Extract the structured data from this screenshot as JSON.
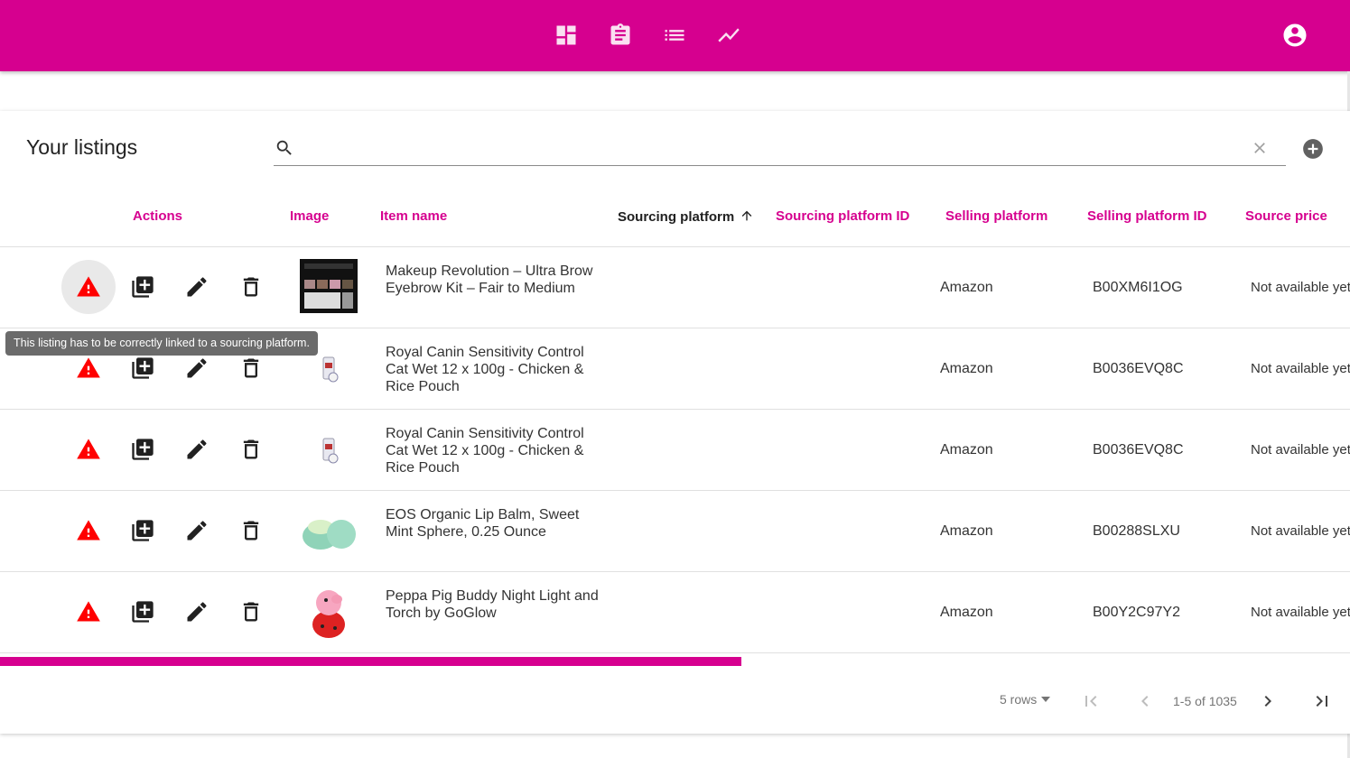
{
  "header": {
    "nav": [
      {
        "name": "dashboard-icon"
      },
      {
        "name": "assignment-icon"
      },
      {
        "name": "list-icon"
      },
      {
        "name": "trending-icon"
      }
    ],
    "account_icon": "account-circle-icon",
    "bg_color": "#d6008f"
  },
  "listings": {
    "title": "Your listings",
    "search": {
      "value": "",
      "placeholder": ""
    },
    "columns": {
      "actions": "Actions",
      "image": "Image",
      "item_name": "Item name",
      "sourcing_platform": "Sourcing platform",
      "sourcing_platform_id": "Sourcing platform ID",
      "selling_platform": "Selling platform",
      "selling_platform_id": "Selling platform ID",
      "source_price": "Source price"
    },
    "sort": {
      "column": "sourcing_platform",
      "direction": "asc"
    },
    "rows": [
      {
        "name": "Makeup Revolution – Ultra Brow Eyebrow Kit – Fair to Medium",
        "sourcing_platform": "",
        "sourcing_platform_id": "",
        "selling_platform": "Amazon",
        "selling_platform_id": "B00XM6I1OG",
        "source_price": "Not available yet",
        "image": "eyebrow-kit-image"
      },
      {
        "name": "Royal Canin Sensitivity Control Cat Wet 12 x 100g - Chicken & Rice Pouch",
        "sourcing_platform": "",
        "sourcing_platform_id": "",
        "selling_platform": "Amazon",
        "selling_platform_id": "B0036EVQ8C",
        "source_price": "Not available yet",
        "image": "cat-food-pouch-image"
      },
      {
        "name": "Royal Canin Sensitivity Control Cat Wet 12 x 100g - Chicken & Rice Pouch",
        "sourcing_platform": "",
        "sourcing_platform_id": "",
        "selling_platform": "Amazon",
        "selling_platform_id": "B0036EVQ8C",
        "source_price": "Not available yet",
        "image": "cat-food-pouch-image"
      },
      {
        "name": "EOS Organic Lip Balm, Sweet Mint Sphere, 0.25 Ounce",
        "sourcing_platform": "",
        "sourcing_platform_id": "",
        "selling_platform": "Amazon",
        "selling_platform_id": "B00288SLXU",
        "source_price": "Not available yet",
        "image": "lip-balm-image"
      },
      {
        "name": "Peppa Pig Buddy Night Light and Torch by GoGlow",
        "sourcing_platform": "",
        "sourcing_platform_id": "",
        "selling_platform": "Amazon",
        "selling_platform_id": "B00Y2C97Y2",
        "source_price": "Not available yet",
        "image": "peppa-pig-light-image"
      }
    ],
    "tooltip": "This listing has to be correctly linked to a sourcing platform.",
    "pagination": {
      "rows_label": "5 rows",
      "info": "1-5 of 1035"
    },
    "colors": {
      "accent": "#d6008f",
      "warning": "#ff0000"
    }
  }
}
